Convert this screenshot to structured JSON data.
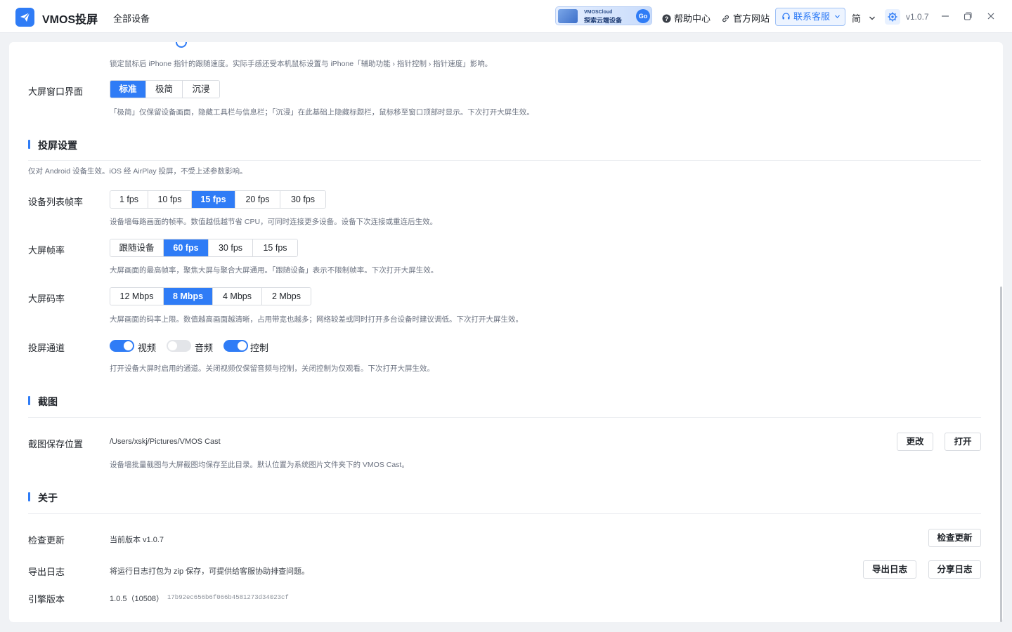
{
  "header": {
    "app_name": "VMOS投屏",
    "nav_all_devices": "全部设备",
    "promo": {
      "line1": "VMOSCloud",
      "line2": "探索云端设备",
      "go": "Go"
    },
    "help_center": "帮助中心",
    "official_site": "官方网站",
    "contact_support": "联系客服",
    "language": "简",
    "version": "v1.0.7"
  },
  "colors": {
    "accent": "#2f7cf6",
    "text": "#1f2329",
    "muted": "#6b7280"
  },
  "pointer_speed": {
    "desc": "锁定鼠标后 iPhone 指针的跟随速度。实际手感还受本机鼠标设置与 iPhone「辅助功能 › 指针控制 › 指针速度」影响。"
  },
  "window_ui": {
    "label": "大屏窗口界面",
    "options": [
      "标准",
      "极简",
      "沉浸"
    ],
    "selected": "标准",
    "desc": "「极简」仅保留设备画面，隐藏工具栏与信息栏；「沉浸」在此基础上隐藏标题栏，鼠标移至窗口顶部时显示。下次打开大屏生效。"
  },
  "cast": {
    "title": "投屏设置",
    "subtitle": "仅对 Android 设备生效。iOS 经 AirPlay 投屏，不受上述参数影响。",
    "list_fps": {
      "label": "设备列表帧率",
      "options": [
        "1 fps",
        "10 fps",
        "15 fps",
        "20 fps",
        "30 fps"
      ],
      "selected": "15 fps",
      "desc": "设备墙每路画面的帧率。数值越低越节省 CPU，可同时连接更多设备。设备下次连接或重连后生效。"
    },
    "big_fps": {
      "label": "大屏帧率",
      "options": [
        "跟随设备",
        "60 fps",
        "30 fps",
        "15 fps"
      ],
      "selected": "60 fps",
      "desc": "大屏画面的最高帧率，聚焦大屏与聚合大屏通用。「跟随设备」表示不限制帧率。下次打开大屏生效。"
    },
    "bitrate": {
      "label": "大屏码率",
      "options": [
        "12 Mbps",
        "8 Mbps",
        "4 Mbps",
        "2 Mbps"
      ],
      "selected": "8 Mbps",
      "desc": "大屏画面的码率上限。数值越高画面越清晰，占用带宽也越多；网络较差或同时打开多台设备时建议调低。下次打开大屏生效。"
    },
    "channels": {
      "label": "投屏通道",
      "video": {
        "label": "视频",
        "on": true
      },
      "audio": {
        "label": "音频",
        "on": false
      },
      "control": {
        "label": "控制",
        "on": true
      },
      "desc": "打开设备大屏时启用的通道。关闭视频仅保留音频与控制，关闭控制为仅观看。下次打开大屏生效。"
    }
  },
  "screenshot": {
    "title": "截图",
    "save_label": "截图保存位置",
    "path": "/Users/xskj/Pictures/VMOS Cast",
    "change_button": "更改",
    "open_button": "打开",
    "desc": "设备墙批量截图与大屏截图均保存至此目录。默认位置为系统图片文件夹下的 VMOS Cast。"
  },
  "about": {
    "title": "关于",
    "update_label": "检查更新",
    "current_version": "当前版本 v1.0.7",
    "check_update_button": "检查更新",
    "log_label": "导出日志",
    "log_desc": "将运行日志打包为 zip 保存，可提供给客服协助排查问题。",
    "export_log_button": "导出日志",
    "share_log_button": "分享日志",
    "engine_label": "引擎版本",
    "engine_version": "1.0.5（10508）",
    "engine_hash": "17b92ec656b6f066b4581273d34023cf"
  }
}
